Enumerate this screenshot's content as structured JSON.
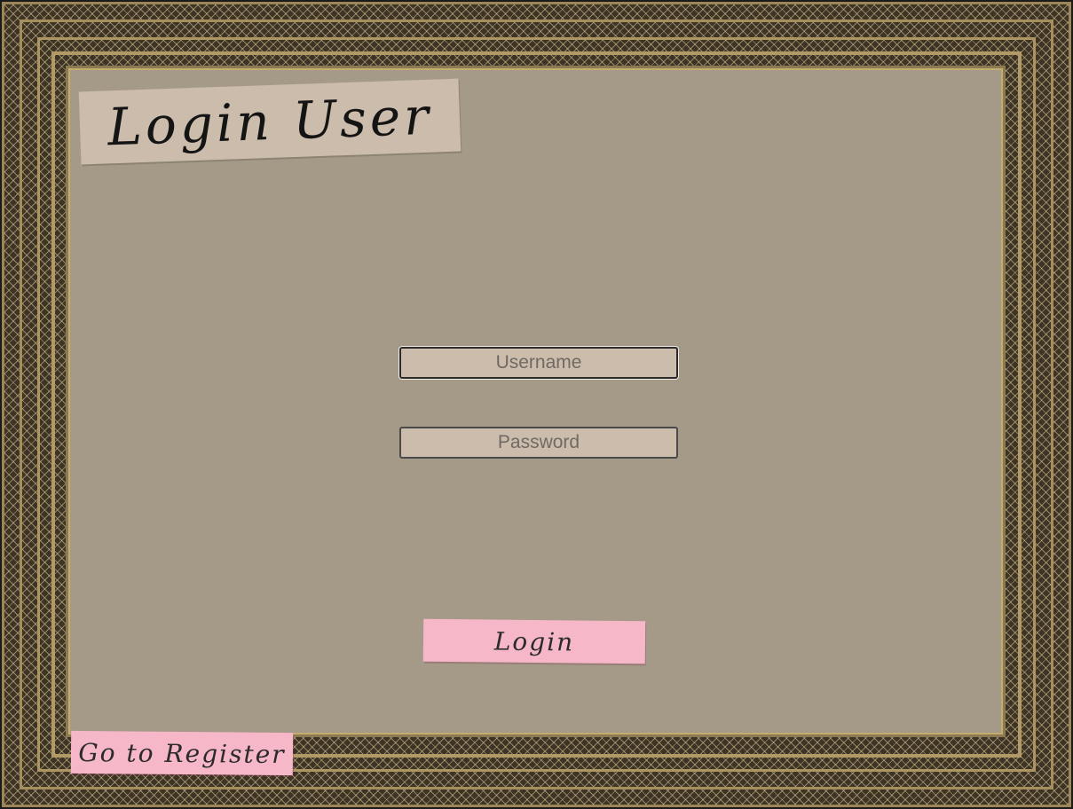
{
  "page": {
    "title": "Login User"
  },
  "form": {
    "username_placeholder": "Username",
    "password_placeholder": "Password",
    "username_value": "",
    "password_value": ""
  },
  "actions": {
    "login_label": "Login",
    "register_label": "Go to Register"
  },
  "colors": {
    "background": "#a59a88",
    "field_background": "#cbbcab",
    "sticky_note": "#f6b7c9",
    "frame": "#3e3426"
  }
}
